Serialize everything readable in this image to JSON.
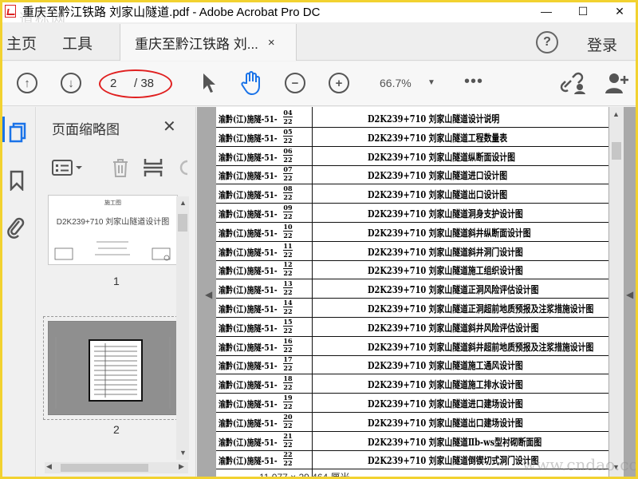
{
  "window": {
    "title": "重庆至黔江铁路 刘家山隧道.pdf - Adobe Acrobat Pro DC",
    "watermark_top": "道标网",
    "controls": {
      "minimize": "—",
      "maximize": "☐",
      "close": "✕"
    }
  },
  "tabs": {
    "home": "主页",
    "tools": "工具",
    "document": "重庆至黔江铁路 刘...",
    "document_close": "×",
    "help": "?",
    "login": "登录"
  },
  "toolbar": {
    "page_current": "2",
    "page_total": "/ 38",
    "zoom": "66.7%",
    "more": "•••"
  },
  "thumbnails_panel": {
    "title": "页面缩略图",
    "close": "✕",
    "thumbnails": [
      {
        "number": "1",
        "heading": "施工图",
        "title": "D2K239+710 刘家山隧道设计图"
      },
      {
        "number": "2"
      }
    ]
  },
  "document": {
    "rows": [
      {
        "code": "渝黔(江)施隧-51-",
        "num": "04",
        "den": "22",
        "title": "D2K239+710  刘家山隧道设计说明"
      },
      {
        "code": "渝黔(江)施隧-51-",
        "num": "05",
        "den": "22",
        "title": "D2K239+710  刘家山隧道工程数量表"
      },
      {
        "code": "渝黔(江)施隧-51-",
        "num": "06",
        "den": "22",
        "title": "D2K239+710  刘家山隧道纵断面设计图"
      },
      {
        "code": "渝黔(江)施隧-51-",
        "num": "07",
        "den": "22",
        "title": "D2K239+710  刘家山隧道进口设计图"
      },
      {
        "code": "渝黔(江)施隧-51-",
        "num": "08",
        "den": "22",
        "title": "D2K239+710  刘家山隧道出口设计图"
      },
      {
        "code": "渝黔(江)施隧-51-",
        "num": "09",
        "den": "22",
        "title": "D2K239+710  刘家山隧道洞身支护设计图"
      },
      {
        "code": "渝黔(江)施隧-51-",
        "num": "10",
        "den": "22",
        "title": "D2K239+710  刘家山隧道斜井纵断面设计图"
      },
      {
        "code": "渝黔(江)施隧-51-",
        "num": "11",
        "den": "22",
        "title": "D2K239+710  刘家山隧道斜井洞门设计图"
      },
      {
        "code": "渝黔(江)施隧-51-",
        "num": "12",
        "den": "22",
        "title": "D2K239+710  刘家山隧道施工组织设计图"
      },
      {
        "code": "渝黔(江)施隧-51-",
        "num": "13",
        "den": "22",
        "title": "D2K239+710  刘家山隧道正洞风险评估设计图"
      },
      {
        "code": "渝黔(江)施隧-51-",
        "num": "14",
        "den": "22",
        "title": "D2K239+710  刘家山隧道正洞超前地质预报及注浆措施设计图"
      },
      {
        "code": "渝黔(江)施隧-51-",
        "num": "15",
        "den": "22",
        "title": "D2K239+710  刘家山隧道斜井风险评估设计图"
      },
      {
        "code": "渝黔(江)施隧-51-",
        "num": "16",
        "den": "22",
        "title": "D2K239+710  刘家山隧道斜井超前地质预报及注浆措施设计图"
      },
      {
        "code": "渝黔(江)施隧-51-",
        "num": "17",
        "den": "22",
        "title": "D2K239+710  刘家山隧道施工通风设计图"
      },
      {
        "code": "渝黔(江)施隧-51-",
        "num": "18",
        "den": "22",
        "title": "D2K239+710  刘家山隧道施工排水设计图"
      },
      {
        "code": "渝黔(江)施隧-51-",
        "num": "19",
        "den": "22",
        "title": "D2K239+710  刘家山隧道进口建场设计图"
      },
      {
        "code": "渝黔(江)施隧-51-",
        "num": "20",
        "den": "22",
        "title": "D2K239+710  刘家山隧道出口建场设计图"
      },
      {
        "code": "渝黔(江)施隧-51-",
        "num": "21",
        "den": "22",
        "title": "D2K239+710  刘家山隧道Ⅱb-ws型衬砌断面图"
      },
      {
        "code": "渝黔(江)施隧-51-",
        "num": "22",
        "den": "22",
        "title": "D2K239+710  刘家山隧道倒锲切式洞门设计图"
      }
    ],
    "bottom_text": "11.077 × 29.464 厘米",
    "watermark": "www.cndao.com"
  },
  "colors": {
    "accent": "#1a73e8",
    "annotation_ellipse": "#e02020",
    "frame": "#f2d230"
  }
}
